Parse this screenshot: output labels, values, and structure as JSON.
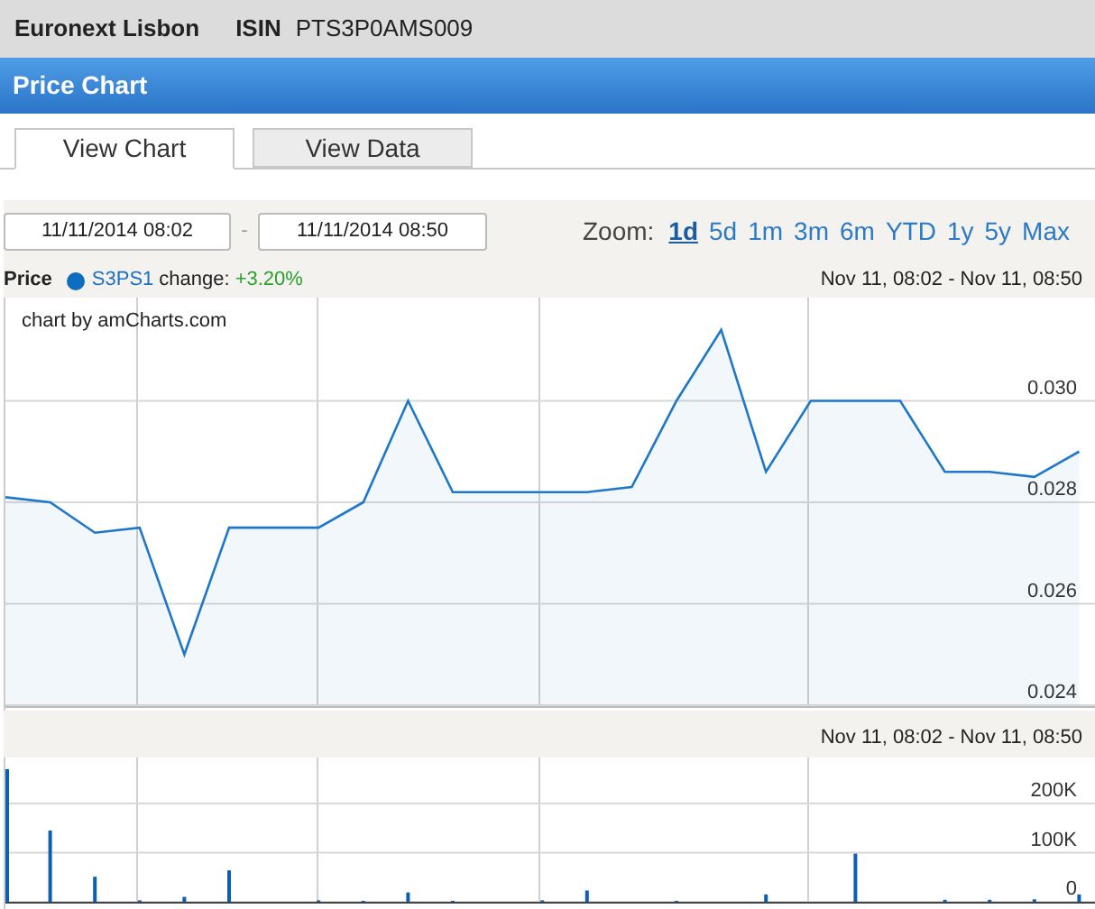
{
  "header": {
    "exchange": "Euronext Lisbon",
    "isin_label": "ISIN",
    "isin": "PTS3P0AMS009"
  },
  "panel": {
    "title": "Price Chart"
  },
  "tabs": [
    {
      "label": "View Chart",
      "selected": true
    },
    {
      "label": "View Data",
      "selected": false
    }
  ],
  "range": {
    "from": "11/11/2014 08:02",
    "separator": "-",
    "to": "11/11/2014 08:50"
  },
  "zoom": {
    "label": "Zoom:",
    "options": [
      {
        "label": "1d",
        "selected": true
      },
      {
        "label": "5d",
        "selected": false
      },
      {
        "label": "1m",
        "selected": false
      },
      {
        "label": "3m",
        "selected": false
      },
      {
        "label": "6m",
        "selected": false
      },
      {
        "label": "YTD",
        "selected": false
      },
      {
        "label": "1y",
        "selected": false
      },
      {
        "label": "5y",
        "selected": false
      },
      {
        "label": "Max",
        "selected": false
      }
    ]
  },
  "legend": {
    "title": "Price",
    "series": "S3PS1",
    "color": "#0d6ebf",
    "change_label": "change:",
    "change": "+3.20%",
    "period": "Nov 11, 08:02 - Nov 11, 08:50"
  },
  "price_chart": {
    "credit": "chart by amCharts.com",
    "chart_data": {
      "type": "area",
      "grid": true,
      "ylim": [
        0.024,
        0.032
      ],
      "yticks": [
        {
          "value": 0.024,
          "label": "0.024"
        },
        {
          "value": 0.026,
          "label": "0.026"
        },
        {
          "value": 0.028,
          "label": "0.028"
        },
        {
          "value": 0.03,
          "label": "0.030"
        }
      ],
      "series": [
        {
          "color": "#1f77c8",
          "values": [
            0.0281,
            0.028,
            0.0274,
            0.0275,
            0.025,
            0.0275,
            0.0275,
            0.0275,
            0.028,
            0.03,
            0.0282,
            0.0282,
            0.0282,
            0.0282,
            0.0283,
            0.03,
            0.0314,
            0.0286,
            0.03,
            0.03,
            0.03,
            0.0286,
            0.0286,
            0.0285,
            0.029
          ]
        }
      ]
    }
  },
  "volume_chart": {
    "period": "Nov 11, 08:02 - Nov 11, 08:50",
    "chart_data": {
      "type": "bar",
      "grid": true,
      "ylim": [
        0,
        290000
      ],
      "yticks": [
        {
          "value": 0,
          "label": "0"
        },
        {
          "value": 100000,
          "label": "100K"
        },
        {
          "value": 200000,
          "label": "200K"
        }
      ],
      "series": [
        {
          "color": "#0d5fb5",
          "values": [
            270000,
            145000,
            51000,
            3000,
            10000,
            64000,
            0,
            3000,
            2000,
            19000,
            2000,
            null,
            3000,
            23000,
            0,
            2000,
            null,
            15000,
            0,
            98000,
            null,
            4000,
            4000,
            5000,
            15000
          ]
        }
      ]
    }
  }
}
